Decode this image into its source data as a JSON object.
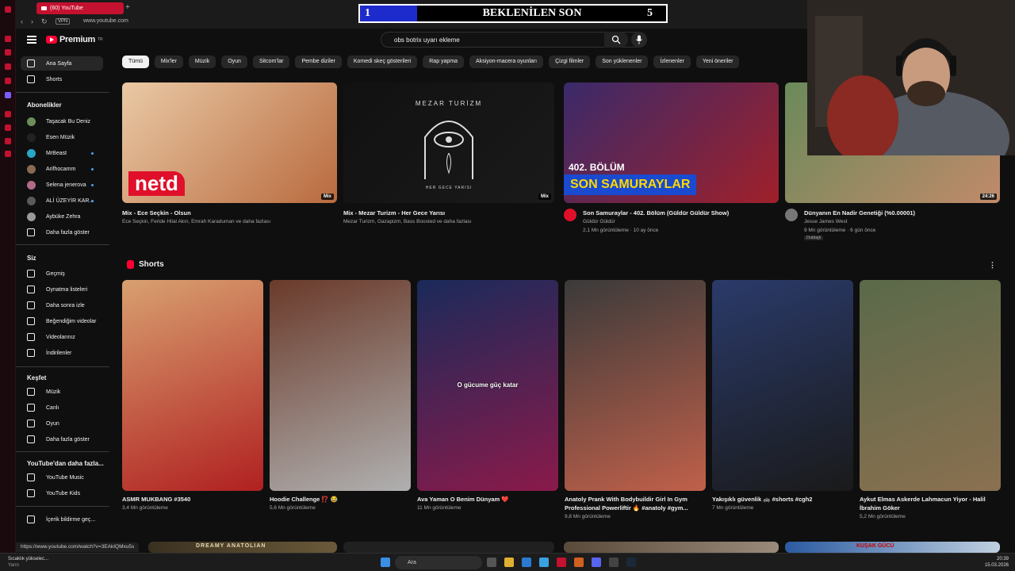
{
  "browser": {
    "tab_title": "(60) YouTube",
    "url": "www.youtube.com",
    "vpn_label": "VPN",
    "status_url": "https://www.youtube.com/watch?v=3EAkIQMxu5s"
  },
  "overlay": {
    "left_num": "1",
    "title": "BEKLENİLEN SON",
    "right_num": "5"
  },
  "masthead": {
    "logo_text": "Premium",
    "logo_sup": "TR",
    "search_value": "obs botrix uyarı ekleme"
  },
  "chips": [
    "Tümü",
    "Mix'ler",
    "Müzik",
    "Oyun",
    "Sitcom'lar",
    "Pembe diziler",
    "Komedi skeç gösterileri",
    "Rap yapma",
    "Aksiyon-macera oyunları",
    "Çizgi filmler",
    "Son yüklenenler",
    "İzlenenler",
    "Yeni öneriler"
  ],
  "sidebar": {
    "main": [
      {
        "label": "Ana Sayfa",
        "icon": "home-icon"
      },
      {
        "label": "Shorts",
        "icon": "shorts-icon"
      }
    ],
    "subscriptions_title": "Abonelikler",
    "subscriptions": [
      {
        "label": "Taşacak Bu Deniz",
        "color": "#6b8e5a"
      },
      {
        "label": "Esen Müzik",
        "color": "#222222"
      },
      {
        "label": "MrBeast",
        "color": "#2aa6c7"
      },
      {
        "label": "Arifhocamm",
        "color": "#8a6a55"
      },
      {
        "label": "Selena jenerova",
        "color": "#b36a8a"
      },
      {
        "label": "ALİ ÜZEYİR KAR...",
        "color": "#5a5a5a"
      },
      {
        "label": "Aybüke Zehra",
        "color": "#9a9a9a"
      }
    ],
    "show_more": "Daha fazla göster",
    "you_title": "Siz",
    "you": [
      {
        "label": "Geçmiş",
        "icon": "history-icon"
      },
      {
        "label": "Oynatma listeleri",
        "icon": "playlists-icon"
      },
      {
        "label": "Daha sonra izle",
        "icon": "watch-later-icon"
      },
      {
        "label": "Beğendiğim videolar",
        "icon": "like-icon"
      },
      {
        "label": "Videolarınız",
        "icon": "your-videos-icon"
      },
      {
        "label": "İndirilenler",
        "icon": "downloads-icon"
      }
    ],
    "explore_title": "Keşfet",
    "explore": [
      {
        "label": "Müzik",
        "icon": "music-icon"
      },
      {
        "label": "Canlı",
        "icon": "live-icon"
      },
      {
        "label": "Oyun",
        "icon": "gaming-icon"
      }
    ],
    "explore_more": "Daha fazla göster",
    "more_title": "YouTube'dan daha fazla...",
    "more": [
      {
        "label": "YouTube Music",
        "icon": "youtube-music-icon"
      },
      {
        "label": "YouTube Kids",
        "icon": "youtube-kids-icon"
      }
    ],
    "report": "İçerik bildirme geç..."
  },
  "videos": [
    {
      "title": "Mix - Ece Seçkin - Olsun",
      "meta1": "Ece Seçkin, Feride Hilal Akın, Emrah Karaduman ve daha fazlası",
      "meta2": "",
      "badge": "Mix",
      "thumb_text": "netd",
      "colors": [
        "#e9c9a5",
        "#b96a3e"
      ]
    },
    {
      "title": "Mix - Mezar Turizm - Her Gece Yarısı",
      "meta1": "Mezar Turizm, Gazapizm, Bass Boosted ve daha fazlası",
      "meta2": "",
      "badge": "Mix",
      "thumb_text": "MEZAR TURİZM",
      "thumb_sub": "HER GECE YARISI",
      "colors": [
        "#111111",
        "#1a1a1a"
      ]
    },
    {
      "title": "Son Samuraylar - 402. Bölüm (Güldür Güldür Show)",
      "meta1": "Güldür Güldür",
      "meta2": "2,1 Mn görüntüleme · 10 ay önce",
      "badge": "",
      "thumb_text": "SON SAMURAYLAR",
      "thumb_sub": "402. BÖLÜM",
      "colors": [
        "#3a2a6a",
        "#a0202a"
      ]
    },
    {
      "title": "Dünyanın En Nadir Genetiği (%0.00001)",
      "meta1": "Jesse James West",
      "meta2": "9 Mn görüntüleme · 6 gün önce",
      "badge": "24:26",
      "extra": "Dublajlı",
      "colors": [
        "#6a8a5a",
        "#c08a6a"
      ]
    }
  ],
  "shorts_title": "Shorts",
  "shorts": [
    {
      "title": "ASMR MUKBANG #3540",
      "meta": "3,4 Mn görüntüleme",
      "colors": [
        "#d8a070",
        "#b02020"
      ]
    },
    {
      "title": "Hoodie Challenge ⁉️ 😂",
      "meta": "5,6 Mn görüntüleme",
      "colors": [
        "#6a3a2a",
        "#b0b0b0"
      ]
    },
    {
      "title": "Ava Yaman O Benim Dünyam ❤️",
      "meta": "11 Mn görüntüleme",
      "caption": "O gücume güç katar",
      "colors": [
        "#1a2a5a",
        "#8a1a4a"
      ]
    },
    {
      "title": "Anatoly Prank With Bodybuildir Girl In Gym",
      "title2": "Professional Powerliftir 🔥 #anatoly #gym...",
      "meta": "9,8 Mn görüntüleme",
      "colors": [
        "#3a3a3a",
        "#c0604a"
      ]
    },
    {
      "title": "Yakışıklı güvenlik 🚓 #shorts #cgh2",
      "meta": "7 Mn görüntüleme",
      "colors": [
        "#2a3a6a",
        "#1a1a1a"
      ]
    },
    {
      "title": "Aykut Elmas Askerde Lahmacun Yiyor - Halil",
      "title2": "İbrahim Göker",
      "meta": "5,2 Mn görüntüleme",
      "colors": [
        "#5a6a4a",
        "#8a7050"
      ]
    }
  ],
  "bottom_row": [
    "DREAMY ANATOLIAN",
    "KUŞAK GÜCÜ"
  ],
  "taskbar": {
    "search": "Ara",
    "notice_title": "Sıcaklık yükselec...",
    "notice_sub": "Yarın",
    "time": "20:39",
    "date": "15.03.2026"
  }
}
